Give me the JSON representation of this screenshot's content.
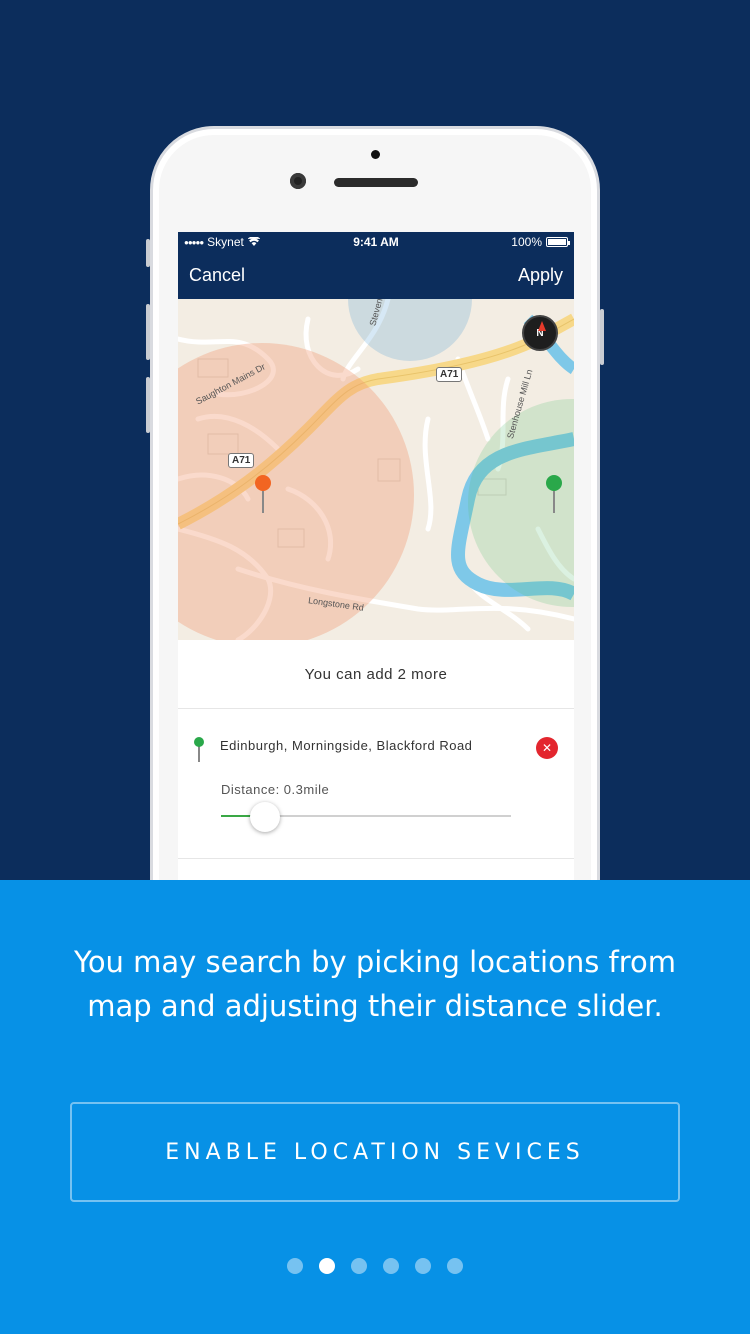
{
  "status_bar": {
    "carrier": "Skynet",
    "time": "9:41 AM",
    "battery": "100%"
  },
  "nav": {
    "cancel_label": "Cancel",
    "apply_label": "Apply"
  },
  "map": {
    "compass_label": "N",
    "road_labels": {
      "saughton": "Saughton Mains Dr",
      "longstone": "Longstone Rd",
      "stenhouse": "Stenhouse Mill Ln",
      "steven": "Steven",
      "a71_top": "A71",
      "a71_left": "A71"
    },
    "pins": [
      {
        "color": "#f26522"
      },
      {
        "color": "#2aa84a"
      }
    ]
  },
  "list": {
    "more_text": "You can add 2 more",
    "items": [
      {
        "name": "Edinburgh, Morningside, Blackford Road",
        "distance_text": "Distance: 0.3mile",
        "slider_value": 0.15,
        "pin_color": "#2aa84a",
        "remove_label": "✕"
      }
    ]
  },
  "onboarding": {
    "description": "You may search by picking locations from map and adjusting their distance slider.",
    "cta_label": "ENABLE LOCATION SEVICES",
    "page_count": 6,
    "active_page": 1
  },
  "colors": {
    "navy": "#0c2d5c",
    "accent_blue": "#0791e6",
    "remove_red": "#e3262e",
    "slider_green": "#3aa845"
  }
}
